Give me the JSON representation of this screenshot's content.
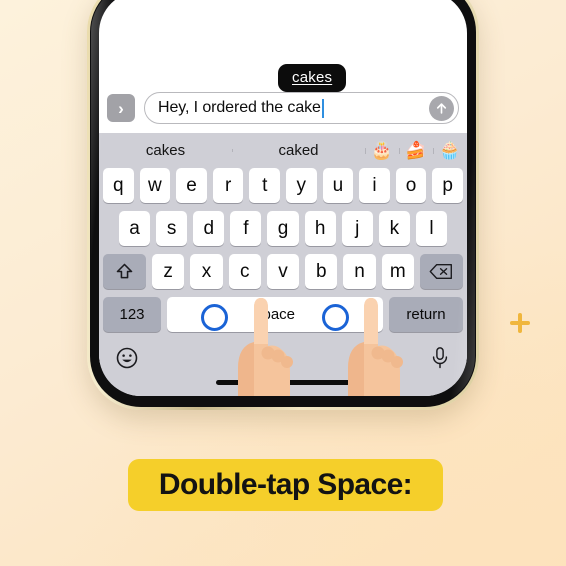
{
  "background": {
    "base_color": "#fbecd0",
    "accent_color": "#f0b63c"
  },
  "sparkle": {
    "name": "sparkle-star",
    "color": "#f0b63c"
  },
  "phone": {
    "frame_color": "#e8d9a8",
    "bezel_color": "#0e0e0f",
    "screen_color": "#ffffff"
  },
  "tooltip": {
    "text": "cakes"
  },
  "compose": {
    "expand_icon": "chevron-right-icon",
    "expand_label": "›",
    "message_text": "Hey, I ordered the cake",
    "caret_color": "#2f8fe0",
    "send_icon": "arrow-up-icon"
  },
  "keyboard": {
    "background_color": "#cfcfd6",
    "predictions": [
      "cakes",
      "caked"
    ],
    "prediction_emojis": [
      "🎂",
      "🍰",
      "🧁"
    ],
    "rows": {
      "row1": [
        "q",
        "w",
        "e",
        "r",
        "t",
        "y",
        "u",
        "i",
        "o",
        "p"
      ],
      "row2": [
        "a",
        "s",
        "d",
        "f",
        "g",
        "h",
        "j",
        "k",
        "l"
      ],
      "row3": [
        "z",
        "x",
        "c",
        "v",
        "b",
        "n",
        "m"
      ]
    },
    "shift_icon": "shift-arrow-icon",
    "backspace_icon": "backspace-icon",
    "numbers_label": "123",
    "space_label": "space",
    "return_label": "return",
    "emoji_icon": "emoji-smiley-icon",
    "mic_icon": "microphone-icon",
    "tap_ring_color": "#1a63d6"
  },
  "hands": {
    "skin_color": "#f5c6a0",
    "count": 2
  },
  "caption": {
    "text": "Double-tap Space:",
    "background_color": "#f5cf2a",
    "text_color": "#131313"
  }
}
